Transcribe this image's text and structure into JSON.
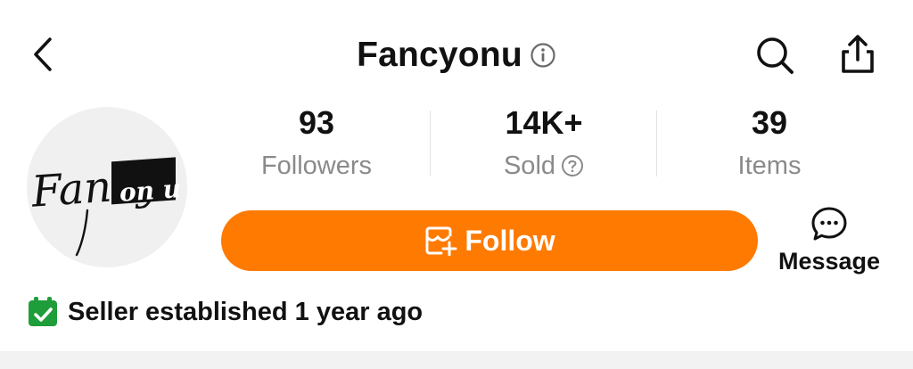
{
  "header": {
    "shop_name": "Fancyonu",
    "icons": {
      "back": "back-chevron-icon",
      "info": "info-icon",
      "search": "search-icon",
      "share": "share-icon"
    }
  },
  "avatar": {
    "logo_text": "Fancy on u"
  },
  "stats": [
    {
      "value": "93",
      "label": "Followers"
    },
    {
      "value": "14K+",
      "label": "Sold"
    },
    {
      "value": "39",
      "label": "Items"
    }
  ],
  "actions": {
    "follow_label": "Follow",
    "message_label": "Message"
  },
  "seller": {
    "established_text": "Seller established 1 year ago"
  },
  "colors": {
    "accent": "#ff7a00",
    "muted_text": "#8a8a8a",
    "calendar_green": "#1f9d3a"
  }
}
